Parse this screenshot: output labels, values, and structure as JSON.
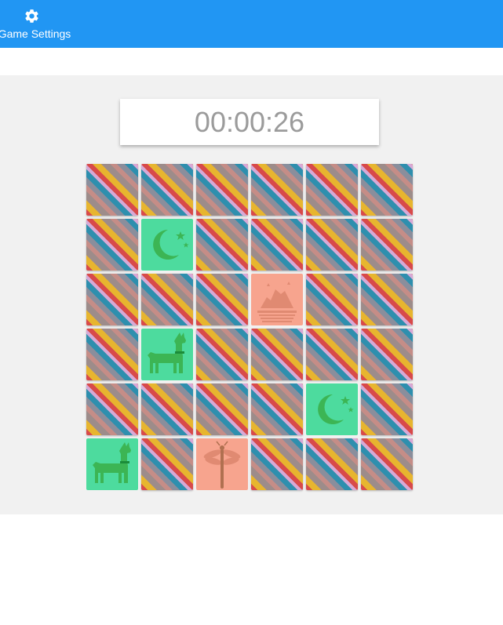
{
  "header": {
    "settings_label": "Game Settings",
    "settings_icon": "gear-icon"
  },
  "timer": {
    "value": "00:00:26"
  },
  "board": {
    "rows": 6,
    "cols": 6,
    "colors": {
      "back_accent": "#2196f3",
      "green_tile": "#4ddb9e",
      "salmon_tile": "#f7a48e",
      "icon_green": "#3cb554",
      "icon_salmon": "#e08a72"
    },
    "revealed": [
      {
        "row": 1,
        "col": 1,
        "icon": "moon-stars-icon",
        "tile": "green"
      },
      {
        "row": 2,
        "col": 3,
        "icon": "mountain-lake-icon",
        "tile": "salmon"
      },
      {
        "row": 3,
        "col": 1,
        "icon": "llama-icon",
        "tile": "green"
      },
      {
        "row": 4,
        "col": 4,
        "icon": "moon-stars-icon",
        "tile": "green"
      },
      {
        "row": 5,
        "col": 0,
        "icon": "llama-icon",
        "tile": "green"
      },
      {
        "row": 5,
        "col": 2,
        "icon": "dragonfly-icon",
        "tile": "salmon"
      }
    ]
  }
}
